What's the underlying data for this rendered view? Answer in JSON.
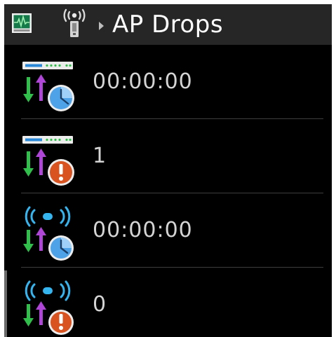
{
  "header": {
    "title": "AP Drops",
    "monitor_icon": "monitor-heartbeat-icon",
    "breadcrumb_icon": "wireless-access-point-icon",
    "separator_icon": "breadcrumb-arrow-icon"
  },
  "rows": [
    {
      "value": "00:00:00",
      "icon": "switch-traffic-clock-icon"
    },
    {
      "value": "1",
      "icon": "switch-traffic-alert-icon"
    },
    {
      "value": "00:00:00",
      "icon": "wireless-traffic-clock-icon"
    },
    {
      "value": "0",
      "icon": "wireless-traffic-alert-icon"
    }
  ],
  "colors": {
    "background": "#000000",
    "header_background": "#262626",
    "text": "#d4d4d4",
    "arrow_down": "#2fbf4a",
    "arrow_up": "#b046d8",
    "clock": "#4ea2e8",
    "alert": "#d8531f",
    "wireless": "#35b5ef"
  }
}
